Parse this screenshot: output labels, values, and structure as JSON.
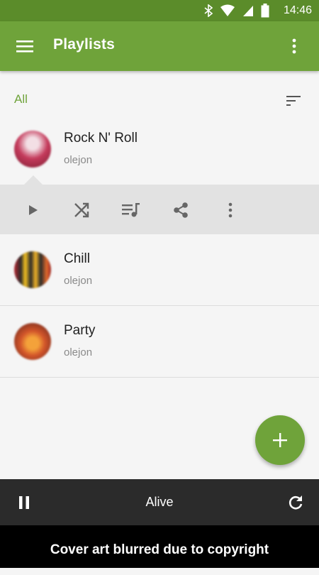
{
  "status_bar": {
    "time": "14:46",
    "icons": [
      "bluetooth-icon",
      "wifi-icon",
      "cell-signal-icon",
      "battery-icon"
    ]
  },
  "app_bar": {
    "title": "Playlists",
    "menu_icon": "hamburger-menu-icon",
    "overflow_icon": "vertical-dots-icon",
    "color": "#6fa33a"
  },
  "filter": {
    "label": "All",
    "sort_icon": "sort-icon"
  },
  "playlists": [
    {
      "name": "Rock N' Roll",
      "owner": "olejon"
    },
    {
      "name": "Chill",
      "owner": "olejon"
    },
    {
      "name": "Party",
      "owner": "olejon"
    }
  ],
  "action_bar": {
    "icons": [
      "play-icon",
      "shuffle-icon",
      "queue-music-icon",
      "share-icon",
      "more-vert-icon"
    ]
  },
  "fab": {
    "icon": "plus-icon"
  },
  "player": {
    "track": "Alive",
    "pause_icon": "pause-icon",
    "repeat_icon": "refresh-icon"
  },
  "caption": "Cover art blurred due to copyright"
}
